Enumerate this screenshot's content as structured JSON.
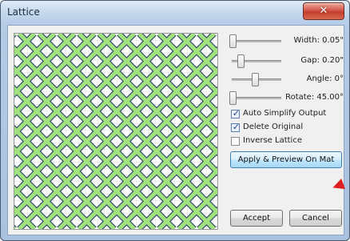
{
  "window": {
    "title": "Lattice",
    "close_label": "✕"
  },
  "controls": {
    "width_label": "Width: 0.05\"",
    "gap_label": "Gap: 0.20\"",
    "angle_label": "Angle: 0°",
    "rotate_label": "Rotate: 45.00°",
    "width_level": 0.0,
    "gap_level": 0.18,
    "angle_level": 0.5,
    "rotate_level": 0.0
  },
  "options": {
    "auto_simplify": {
      "label": "Auto Simplify Output",
      "checked": true
    },
    "delete_original": {
      "label": "Delete Original",
      "checked": true
    },
    "inverse_lattice": {
      "label": "Inverse Lattice",
      "checked": false
    }
  },
  "buttons": {
    "apply_preview": "Apply & Preview On Mat",
    "accept": "Accept",
    "cancel": "Cancel"
  },
  "colors": {
    "lattice_green": "#9fe27e",
    "lattice_outline": "#39506c",
    "mat_grid": "#d8d8d8",
    "accent_arrow": "#e02020"
  },
  "icons": {
    "close": "close-icon",
    "check": "checkmark-icon",
    "arrow": "red-pointer-arrow-icon"
  }
}
